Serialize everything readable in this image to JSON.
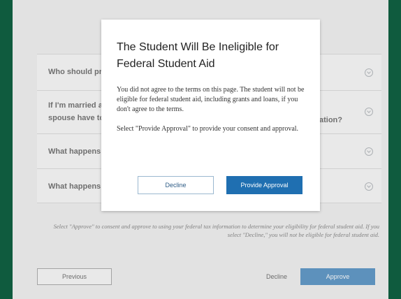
{
  "faq": {
    "items": [
      {
        "question": "Who should pro",
        "tail": ""
      },
      {
        "question_line1": "If I'm married a",
        "question_line2": "spouse have to",
        "tail": "ation?"
      },
      {
        "question": "What happens",
        "tail": ""
      },
      {
        "question": "What happens",
        "tail": ""
      }
    ]
  },
  "consent_note": "Select \"Approve\" to consent and approve to using your federal tax information to determine your eligibility for federal student aid. If you select \"Decline,\" you will not be eligible for federal student aid.",
  "footer": {
    "previous_label": "Previous",
    "decline_label": "Decline",
    "approve_label": "Approve"
  },
  "modal": {
    "title": "The Student Will Be Ineligible for Federal Student Aid",
    "body_p1": "You did not agree to the terms on this page. The student will not be eligible for federal student aid, including grants and loans, if you don't agree to the terms.",
    "body_p2": "Select \"Provide Approval\" to provide your consent and approval.",
    "decline_label": "Decline",
    "approve_label": "Provide Approval"
  },
  "colors": {
    "frame": "#0f5b3e",
    "primary": "#1f6fb1"
  }
}
